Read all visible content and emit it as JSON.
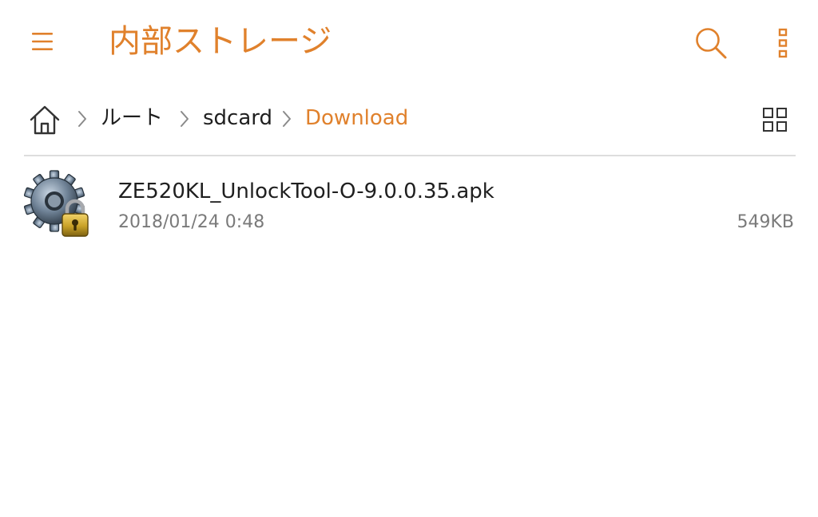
{
  "colors": {
    "accent": "#E0812C",
    "text_primary": "#1F1F1F",
    "text_secondary": "#7A7A7A",
    "icon_gray": "#333333",
    "separator_gray": "#8A8A8A",
    "divider": "#DDDDDD",
    "background": "#FFFFFF"
  },
  "appbar": {
    "title": "内部ストレージ",
    "menu_icon": "hamburger-menu-icon",
    "search_icon": "search-icon",
    "more_icon": "more-vertical-icon"
  },
  "breadcrumb": {
    "home_icon": "home-icon",
    "separator_icon": "chevron-right-icon",
    "items": [
      {
        "label": "ルート"
      },
      {
        "label": "sdcard"
      },
      {
        "label": "Download"
      }
    ],
    "view_toggle_icon": "grid-view-icon"
  },
  "files": [
    {
      "name": "ZE520KL_UnlockTool-O-9.0.0.35.apk",
      "date": "2018/01/24 0:48",
      "size": "549KB",
      "icon": "gear-lock-icon"
    }
  ]
}
